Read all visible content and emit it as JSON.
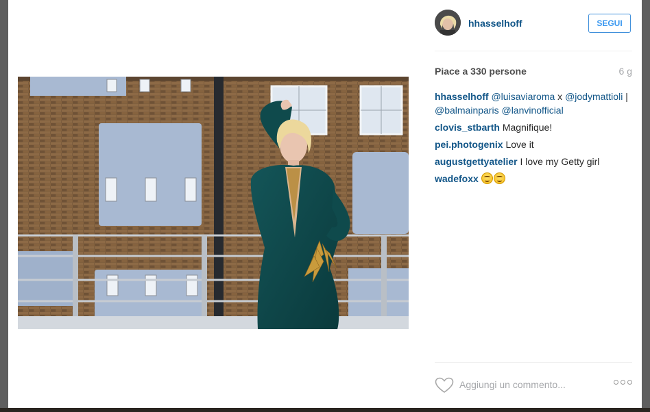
{
  "post": {
    "username": "hhasselhoff",
    "follow_label": "SEGUI",
    "likes_text": "Piace a 330 persone",
    "age_text": "6 g"
  },
  "comments": [
    {
      "author": "hhasselhoff",
      "parts": [
        {
          "type": "mention",
          "text": "@luisaviaroma"
        },
        {
          "type": "text",
          "text": " x "
        },
        {
          "type": "mention",
          "text": "@jodymattioli"
        },
        {
          "type": "text",
          "text": " | "
        },
        {
          "type": "mention",
          "text": "@balmainparis"
        },
        {
          "type": "text",
          "text": " "
        },
        {
          "type": "mention",
          "text": "@lanvinofficial"
        }
      ]
    },
    {
      "author": "clovis_stbarth",
      "parts": [
        {
          "type": "text",
          "text": " Magnifique!"
        }
      ]
    },
    {
      "author": "pei.photogenix",
      "parts": [
        {
          "type": "text",
          "text": " Love it"
        }
      ]
    },
    {
      "author": "augustgettyatelier",
      "parts": [
        {
          "type": "text",
          "text": " I love my Getty girl"
        }
      ]
    },
    {
      "author": "wadefoxx",
      "parts": [
        {
          "type": "text",
          "text": " "
        },
        {
          "type": "emoji",
          "name": "smiling-face-emoji"
        },
        {
          "type": "emoji",
          "name": "smiling-face-emoji"
        }
      ]
    }
  ],
  "footer": {
    "comment_placeholder": "Aggiungi un commento...",
    "like_icon": "heart-outline-icon",
    "more_icon": "more-options-icon"
  },
  "colors": {
    "link": "#125688",
    "follow_accent": "#3897f0",
    "muted": "#a5a7aa",
    "dress": "#0f4a4c",
    "brick": "#7a5a3c"
  }
}
